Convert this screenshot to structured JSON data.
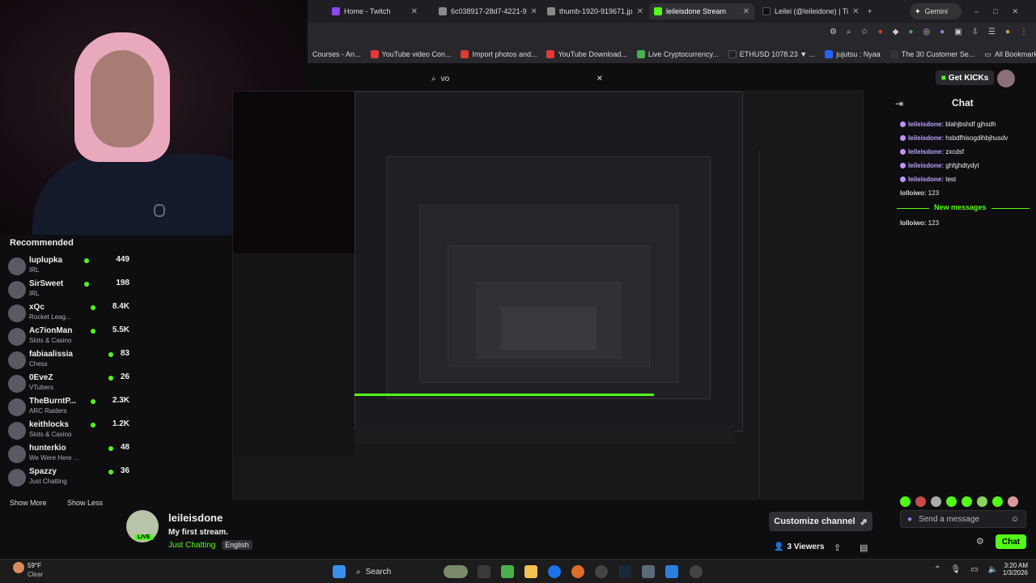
{
  "browser": {
    "tabs": [
      {
        "label": "Home - Twitch",
        "color": "#9146ff"
      },
      {
        "label": "6c038917-28d7-4221-9",
        "color": "#8a8a8a"
      },
      {
        "label": "thumb-1920-919671.jp",
        "color": "#8a8a8a"
      },
      {
        "label": "leileisdone Stream",
        "color": "#53fc18",
        "active": true
      },
      {
        "label": "Leilei (@leileidone) | Ti",
        "color": "#111111"
      }
    ],
    "gemini_label": "Gemini",
    "bookmarks": [
      {
        "label": "Courses - An...",
        "color": "#999999"
      },
      {
        "label": "YouTube video Con...",
        "color": "#e53935"
      },
      {
        "label": "Import photos and...",
        "color": "#e53935"
      },
      {
        "label": "YouTube Download...",
        "color": "#e53935"
      },
      {
        "label": "Live Cryptocurrency...",
        "color": "#4caf50"
      },
      {
        "label": "ETHUSD 1078.23 ▼ ...",
        "color": "#222222"
      },
      {
        "label": "jujutsu : Nyaa",
        "color": "#2962ff"
      },
      {
        "label": "The 30 Customer Se...",
        "color": "#333333"
      }
    ],
    "all_bookmarks": "All Bookmarks"
  },
  "search": {
    "value": "vo"
  },
  "header": {
    "get_kicks": "Get KICKs"
  },
  "sidebar": {
    "title": "Recommended",
    "channels": [
      {
        "name": "luplupka",
        "category": "IRL",
        "viewers": "449"
      },
      {
        "name": "SirSweet",
        "category": "IRL",
        "viewers": "198"
      },
      {
        "name": "xQc",
        "category": "Rocket Leag...",
        "viewers": "8.4K"
      },
      {
        "name": "Ac7ionMan",
        "category": "Slots & Casino",
        "viewers": "5.5K"
      },
      {
        "name": "fabiaalissia",
        "category": "Chess",
        "viewers": "83"
      },
      {
        "name": "0EveZ",
        "category": "VTubers",
        "viewers": "26"
      },
      {
        "name": "TheBurntP...",
        "category": "ARC Raiders",
        "viewers": "2.3K"
      },
      {
        "name": "keithlocks",
        "category": "Slots & Casino",
        "viewers": "1.2K"
      },
      {
        "name": "hunterkio",
        "category": "We Were Here ...",
        "viewers": "48"
      },
      {
        "name": "Spazzy",
        "category": "Just Chatting",
        "viewers": "36"
      }
    ],
    "show_more": "Show More",
    "show_less": "Show Less"
  },
  "chat": {
    "title": "Chat",
    "messages": [
      {
        "user": "leileisdone:",
        "text": "blahjbshdf gjhsdh",
        "badge": true
      },
      {
        "user": "leileisdone:",
        "text": "hsbdfhisogdihbjhusdv",
        "badge": true
      },
      {
        "user": "leileisdone:",
        "text": "zxcdsf",
        "badge": true
      },
      {
        "user": "leileisdone:",
        "text": "ghfghdtydyt",
        "badge": true
      },
      {
        "user": "leileisdone:",
        "text": "test",
        "badge": true
      },
      {
        "user": "lolloiwo:",
        "text": "123",
        "badge": false
      }
    ],
    "new_messages": "New messages",
    "after": [
      {
        "user": "lolloiwo:",
        "text": "123"
      }
    ],
    "placeholder": "Send a message",
    "chat_button": "Chat"
  },
  "stream": {
    "channel": "leileisdone",
    "title": "My first stream.",
    "category": "Just Chatting",
    "language": "English",
    "live": "LIVE",
    "customize": "Customize channel",
    "viewers": "3 Viewers"
  },
  "taskbar": {
    "weather_temp": "59°F",
    "weather_desc": "Clear",
    "search_label": "Search",
    "time": "3:20 AM",
    "date": "1/3/2026"
  }
}
